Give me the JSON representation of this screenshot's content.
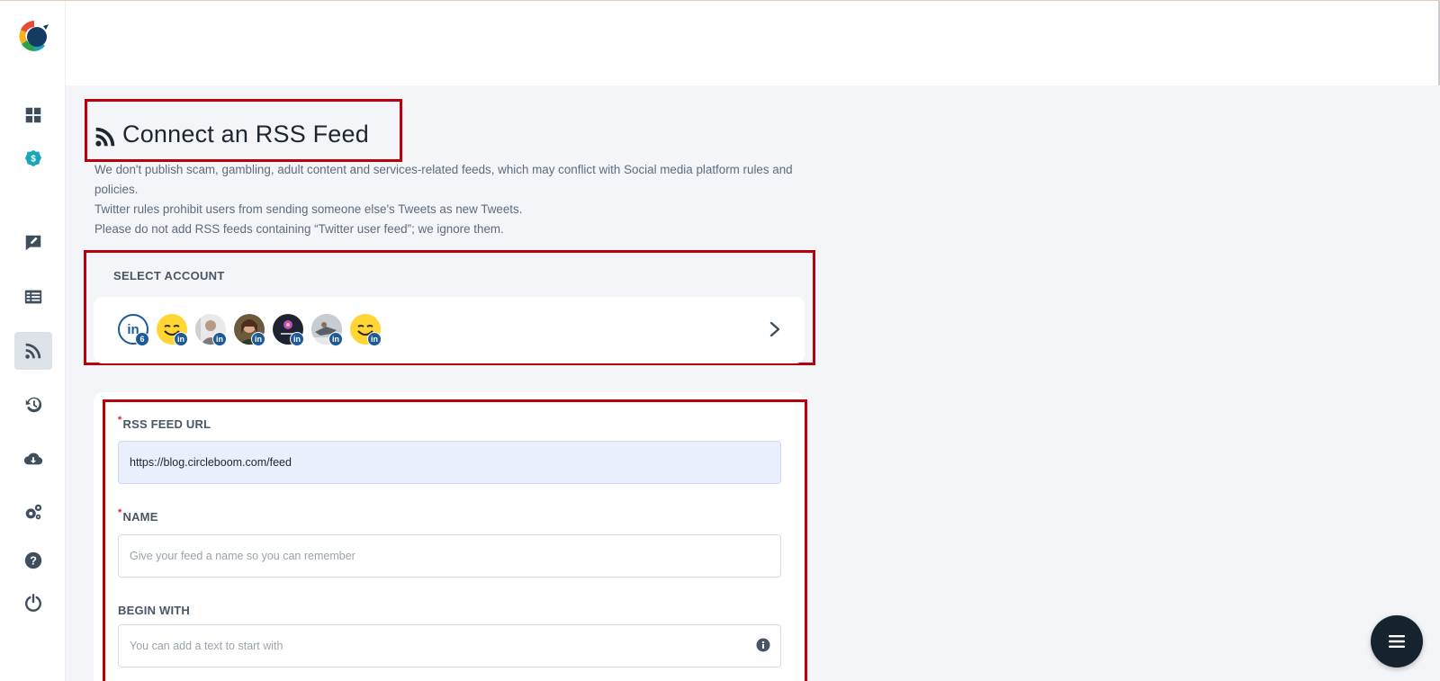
{
  "page": {
    "title": "Connect an RSS Feed",
    "notice_lines": [
      "We don't publish scam, gambling, adult content and services-related feeds, which may conflict with Social media platform rules and policies.",
      "Twitter rules prohibit users from sending someone else's Tweets as new Tweets.",
      "Please do not add RSS feeds containing “Twitter user feed”; we ignore them."
    ]
  },
  "sidebar": {
    "items": [
      {
        "name": "dashboard-icon"
      },
      {
        "name": "pricing-icon"
      },
      {
        "name": "compose-icon"
      },
      {
        "name": "queue-icon"
      },
      {
        "name": "rss-icon"
      },
      {
        "name": "history-icon"
      },
      {
        "name": "download-icon"
      },
      {
        "name": "settings-icon"
      },
      {
        "name": "help-icon"
      },
      {
        "name": "logout-icon"
      }
    ]
  },
  "accounts": {
    "label": "SELECT ACCOUNT",
    "count_badge": "6",
    "network_badge": "in",
    "platform_icon_text": "in",
    "avatars": [
      {
        "name": "avatar-smiley-1",
        "kind": "smiley"
      },
      {
        "name": "avatar-person-1",
        "kind": "person-light"
      },
      {
        "name": "avatar-person-2",
        "kind": "person-dark"
      },
      {
        "name": "avatar-marketing",
        "kind": "dark-logo"
      },
      {
        "name": "avatar-person-3",
        "kind": "person-grey"
      },
      {
        "name": "avatar-smiley-2",
        "kind": "smiley"
      }
    ]
  },
  "form": {
    "feed_url": {
      "label": "RSS FEED URL",
      "required_mark": "*",
      "value": "https://blog.circleboom.com/feed"
    },
    "name": {
      "label": "NAME",
      "required_mark": "*",
      "placeholder": "Give your feed a name so you can remember"
    },
    "begin_with": {
      "label": "BEGIN WITH",
      "placeholder": "You can add a text to start with"
    }
  },
  "colors": {
    "accent": "#1d5a99",
    "highlight": "#b8000a",
    "teal": "#1aa6b7",
    "fab": "#17222f"
  }
}
